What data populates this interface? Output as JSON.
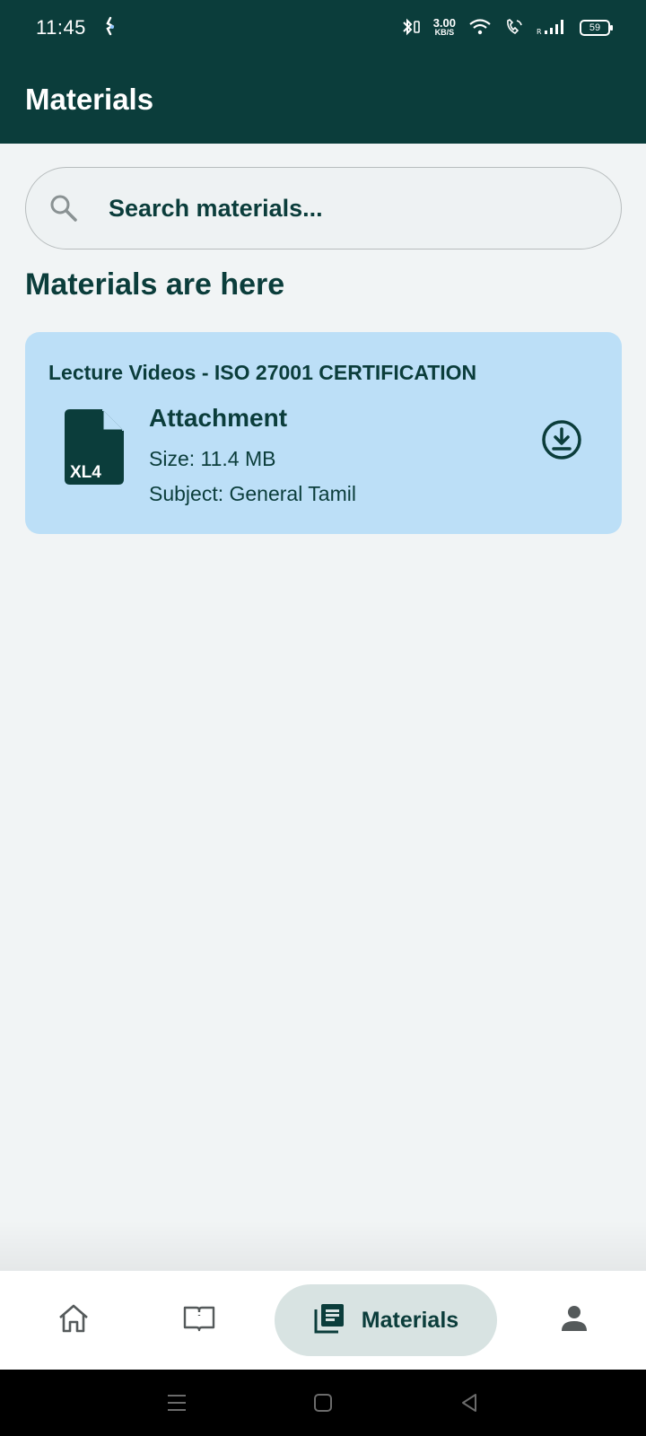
{
  "status_bar": {
    "time": "11:45",
    "net_speed_value": "3.00",
    "net_speed_unit": "KB/S",
    "battery": "59"
  },
  "app_bar": {
    "title": "Materials"
  },
  "search": {
    "placeholder": "Search materials..."
  },
  "section": {
    "title": "Materials are here"
  },
  "materials": [
    {
      "title": "Lecture Videos - ISO 27001 CERTIFICATION",
      "file_ext": "XL4",
      "attachment_label": "Attachment",
      "size": "Size: 11.4 MB",
      "subject": "Subject: General Tamil"
    }
  ],
  "bottom_nav": {
    "items": [
      {
        "icon": "home-icon"
      },
      {
        "icon": "book-icon"
      },
      {
        "icon": "library-icon",
        "label": "Materials",
        "active": true
      },
      {
        "icon": "person-icon"
      }
    ]
  },
  "colors": {
    "primary": "#0b3d3b",
    "card": "#bcdff7",
    "background": "#f1f4f5",
    "nav_active": "#d8e3e2"
  }
}
